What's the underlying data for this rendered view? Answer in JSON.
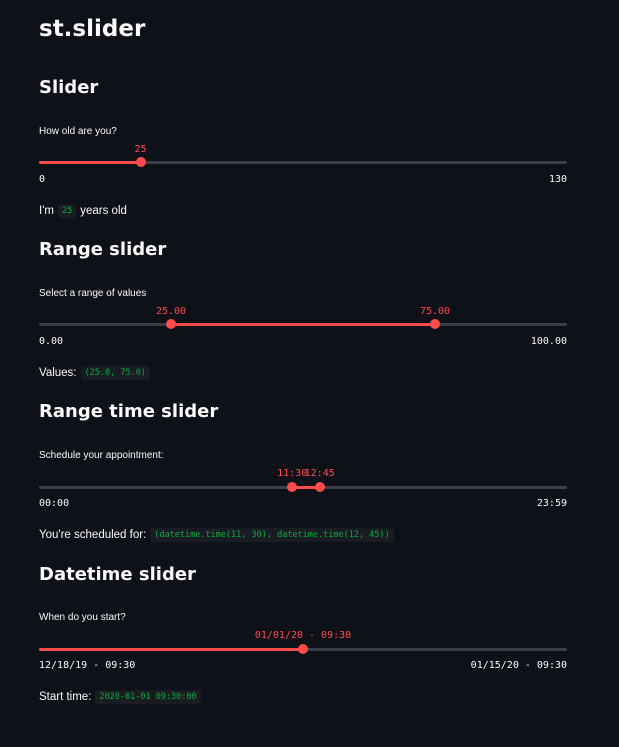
{
  "title": "st.slider",
  "slider": {
    "heading": "Slider",
    "label": "How old are you?",
    "min": 0,
    "max": 130,
    "min_label": "0",
    "max_label": "130",
    "value": 25,
    "value_label": "25",
    "result_prefix": "I'm",
    "result_code": "25",
    "result_suffix": "years old"
  },
  "range_slider": {
    "heading": "Range slider",
    "label": "Select a range of values",
    "min": 0,
    "max": 100,
    "min_label": "0.00",
    "max_label": "100.00",
    "low": 25,
    "high": 75,
    "low_label": "25.00",
    "high_label": "75.00",
    "result_prefix": "Values:",
    "result_code": "(25.0, 75.0)"
  },
  "range_time_slider": {
    "heading": "Range time slider",
    "label": "Schedule your appointment:",
    "min_minutes": 0,
    "max_minutes": 1439,
    "min_label": "00:00",
    "max_label": "23:59",
    "low_minutes": 690,
    "high_minutes": 765,
    "low_label": "11:30",
    "high_label": "12:45",
    "result_prefix": "You're scheduled for:",
    "result_code": "(datetime.time(11, 30), datetime.time(12, 45))"
  },
  "datetime_slider": {
    "heading": "Datetime slider",
    "label": "When do you start?",
    "min_label": "12/18/19 - 09:30",
    "max_label": "01/15/20 - 09:30",
    "value_label": "01/01/20 - 09:30",
    "min_day": 0,
    "max_day": 28,
    "value_day": 14,
    "result_prefix": "Start time:",
    "result_code": "2020-01-01 09:30:00"
  },
  "colors": {
    "accent": "#ff4b4b",
    "background": "#0e1117",
    "track": "#3b3f49",
    "code_text": "#09ab3b"
  }
}
